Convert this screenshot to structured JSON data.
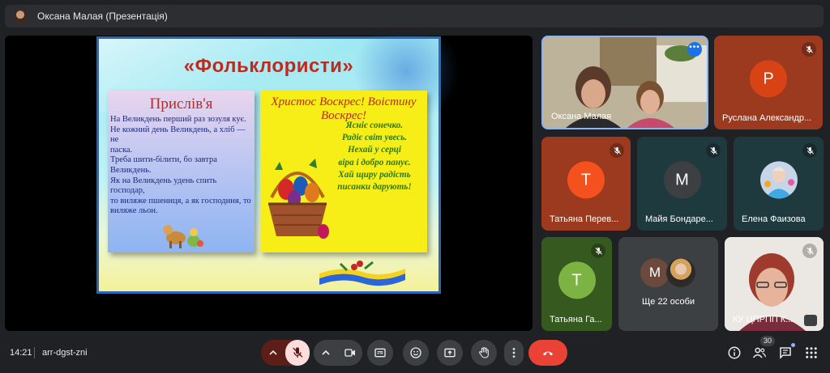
{
  "topbar": {
    "title": "Оксана Малая (Презентація)"
  },
  "slide": {
    "title": "«Фольклористи»",
    "left": {
      "title": "Прислів'я",
      "lines": [
        "На Великдень перший раз зозуля кує.",
        "Не кожний день Великдень, а хліб — не",
        "паска.",
        "Треба шити-білити, бо завтра",
        "Великдень.",
        "Як на Великдень удень спить господар,",
        "то виляже пшениця, а як господиня, то",
        "виляже льон."
      ]
    },
    "right": {
      "title": "Христос Воскрес! Воістину Воскрес!",
      "lines": [
        "Ясніє сонечко.",
        "Радіє світ увесь.",
        "Нехай у серці",
        "віра і добро панує.",
        "Хай щиру радість",
        "писанки дарують!"
      ]
    }
  },
  "participants": {
    "oksana": {
      "name": "Оксана Малая"
    },
    "ruslana": {
      "name": "Руслана Александр...",
      "letter": "Р",
      "color": "#d84315"
    },
    "tatyana_p": {
      "name": "Татьяна Перев...",
      "letter": "Т",
      "color": "#f4511e"
    },
    "maya": {
      "name": "Майя Бондаре...",
      "letter": "М",
      "color": "#3c4043"
    },
    "elena": {
      "name": "Елена Фаизова"
    },
    "tatyana_g": {
      "name": "Татьяна Га...",
      "letter": "Т",
      "color": "#7cb342"
    },
    "more": {
      "letter": "М",
      "text": "Ще 22 особи"
    },
    "ku": {
      "name": "КУ ЦПРПП К..."
    }
  },
  "bottombar": {
    "time": "14:21",
    "meeting_code": "arr-dgst-zni",
    "participant_count": "30"
  },
  "icons": {
    "mic_off": "mic-off-icon",
    "camera": "camera-icon",
    "captions": "captions-icon",
    "emoji": "emoji-icon",
    "present": "present-icon",
    "hand": "raise-hand-icon",
    "more": "more-vert-icon",
    "end_call": "end-call-icon",
    "info": "info-icon",
    "people": "people-icon",
    "chat": "chat-icon",
    "apps": "apps-icon"
  },
  "colors": {
    "end_call": "#ea4335",
    "mic_off_bg": "#f9dedc",
    "active_border": "#8ab4f8"
  }
}
